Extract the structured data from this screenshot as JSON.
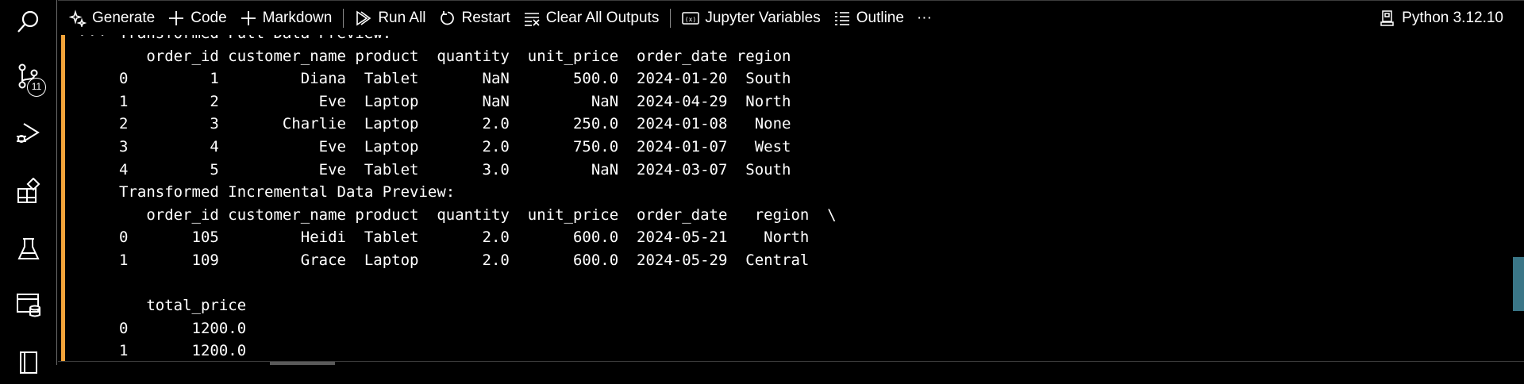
{
  "activity_bar": {
    "items": [
      {
        "name": "search-icon"
      },
      {
        "name": "source-control-icon",
        "badge": "11"
      },
      {
        "name": "run-debug-icon"
      },
      {
        "name": "extensions-icon"
      },
      {
        "name": "testing-icon"
      },
      {
        "name": "database-icon"
      },
      {
        "name": "notebook-icon"
      }
    ]
  },
  "toolbar": {
    "generate": "Generate",
    "code": "Code",
    "markdown": "Markdown",
    "run_all": "Run All",
    "restart": "Restart",
    "clear_outputs": "Clear All Outputs",
    "variables": "Jupyter Variables",
    "outline": "Outline",
    "more": "···",
    "kernel": "Python 3.12.10"
  },
  "output": {
    "collapse_marker": "···",
    "text": "Transformed Full Data Preview:\n   order_id customer_name product  quantity  unit_price  order_date region\n0         1         Diana  Tablet       NaN       500.0  2024-01-20  South\n1         2           Eve  Laptop       NaN         NaN  2024-04-29  North\n2         3       Charlie  Laptop       2.0       250.0  2024-01-08   None\n3         4           Eve  Laptop       2.0       750.0  2024-01-07   West\n4         5           Eve  Tablet       3.0         NaN  2024-03-07  South\nTransformed Incremental Data Preview:\n   order_id customer_name product  quantity  unit_price  order_date   region  \\\n0       105         Heidi  Tablet       2.0       600.0  2024-05-21    North\n1       109         Grace  Laptop       2.0       600.0  2024-05-29  Central\n\n   total_price\n0       1200.0\n1       1200.0"
  },
  "colors": {
    "background": "#000000",
    "cell_indicator": "#f2a33a",
    "scrollbar_thumb": "#3a7687",
    "text": "#ffffff"
  }
}
